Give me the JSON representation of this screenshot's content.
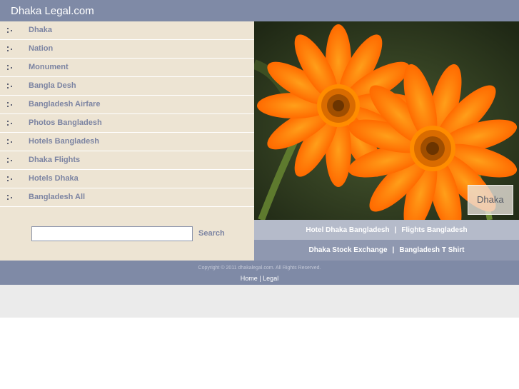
{
  "header": {
    "site_title": "Dhaka Legal.com"
  },
  "nav": {
    "items": [
      {
        "label": "Dhaka"
      },
      {
        "label": "Nation"
      },
      {
        "label": "Monument"
      },
      {
        "label": "Bangla Desh"
      },
      {
        "label": "Bangladesh Airfare"
      },
      {
        "label": "Photos Bangladesh"
      },
      {
        "label": "Hotels Bangladesh"
      },
      {
        "label": "Dhaka Flights"
      },
      {
        "label": "Hotels Dhaka"
      },
      {
        "label": "Bangladesh All"
      }
    ]
  },
  "search": {
    "value": "",
    "button_label": "Search"
  },
  "photo": {
    "caption": "Dhaka"
  },
  "links_row1": [
    "Hotel Dhaka Bangladesh",
    "Flights Bangladesh"
  ],
  "links_row2": [
    "Dhaka Stock Exchange",
    "Bangladesh T Shirt"
  ],
  "separator": "|",
  "footer": {
    "copyright": "Copyright © 2011 dhakalegal.com. All Rights Reserved.",
    "link_home": "Home",
    "link_sep": "|",
    "link_legal": "Legal"
  }
}
